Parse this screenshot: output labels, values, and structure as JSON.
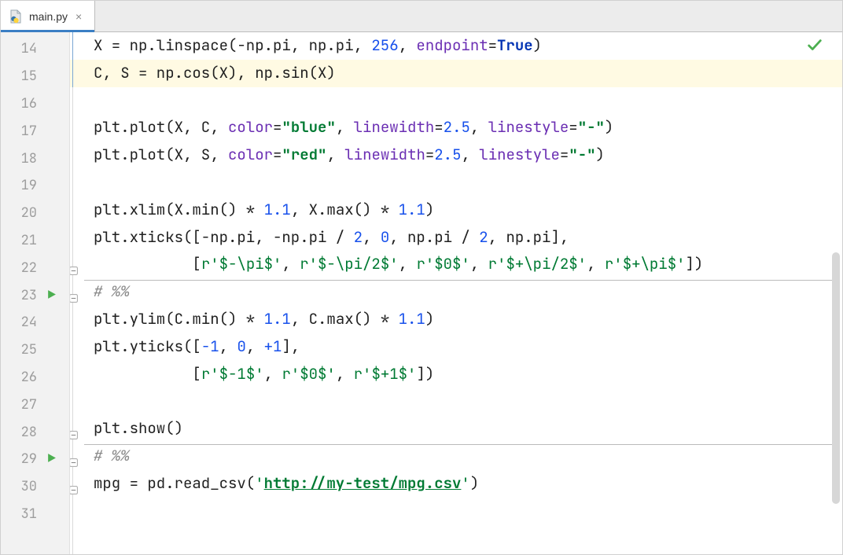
{
  "tab": {
    "filename": "main.py",
    "close_glyph": "×"
  },
  "analysis": {
    "status": "ok"
  },
  "gutter": {
    "first_line": 14,
    "run_markers": [
      23,
      29
    ]
  },
  "current_line": 15,
  "cell_separators": [
    22,
    28
  ],
  "code": {
    "14": [
      {
        "t": "X = np.linspace(-np.pi, np.pi, "
      },
      {
        "t": "256",
        "c": "tk-num"
      },
      {
        "t": ", "
      },
      {
        "t": "endpoint",
        "c": "tk-kwarg"
      },
      {
        "t": "="
      },
      {
        "t": "True",
        "c": "tk-kw"
      },
      {
        "t": ")"
      }
    ],
    "15": [
      {
        "t": "C, S = np.cos(X), np.sin(X)"
      }
    ],
    "16": [],
    "17": [
      {
        "t": "plt.plot(X, C, "
      },
      {
        "t": "color",
        "c": "tk-kwarg"
      },
      {
        "t": "="
      },
      {
        "t": "\"blue\"",
        "c": "tk-str"
      },
      {
        "t": ", "
      },
      {
        "t": "linewidth",
        "c": "tk-kwarg"
      },
      {
        "t": "="
      },
      {
        "t": "2.5",
        "c": "tk-num"
      },
      {
        "t": ", "
      },
      {
        "t": "linestyle",
        "c": "tk-kwarg"
      },
      {
        "t": "="
      },
      {
        "t": "\"-\"",
        "c": "tk-str"
      },
      {
        "t": ")"
      }
    ],
    "18": [
      {
        "t": "plt.plot(X, S, "
      },
      {
        "t": "color",
        "c": "tk-kwarg"
      },
      {
        "t": "="
      },
      {
        "t": "\"red\"",
        "c": "tk-str"
      },
      {
        "t": ", "
      },
      {
        "t": "linewidth",
        "c": "tk-kwarg"
      },
      {
        "t": "="
      },
      {
        "t": "2.5",
        "c": "tk-num"
      },
      {
        "t": ", "
      },
      {
        "t": "linestyle",
        "c": "tk-kwarg"
      },
      {
        "t": "="
      },
      {
        "t": "\"-\"",
        "c": "tk-str"
      },
      {
        "t": ")"
      }
    ],
    "19": [],
    "20": [
      {
        "t": "plt.xlim(X.min() * "
      },
      {
        "t": "1.1",
        "c": "tk-num"
      },
      {
        "t": ", X.max() * "
      },
      {
        "t": "1.1",
        "c": "tk-num"
      },
      {
        "t": ")"
      }
    ],
    "21": [
      {
        "t": "plt.xticks([-np.pi, -np.pi / "
      },
      {
        "t": "2",
        "c": "tk-num"
      },
      {
        "t": ", "
      },
      {
        "t": "0",
        "c": "tk-num"
      },
      {
        "t": ", np.pi / "
      },
      {
        "t": "2",
        "c": "tk-num"
      },
      {
        "t": ", np.pi],"
      }
    ],
    "22": [
      {
        "t": "           ["
      },
      {
        "t": "r'$-\\pi$'",
        "c": "tk-strp"
      },
      {
        "t": ", "
      },
      {
        "t": "r'$-\\pi/2$'",
        "c": "tk-strp"
      },
      {
        "t": ", "
      },
      {
        "t": "r'$0$'",
        "c": "tk-strp"
      },
      {
        "t": ", "
      },
      {
        "t": "r'$+\\pi/2$'",
        "c": "tk-strp"
      },
      {
        "t": ", "
      },
      {
        "t": "r'$+\\pi$'",
        "c": "tk-strp"
      },
      {
        "t": "])"
      }
    ],
    "23": [
      {
        "t": "# %%",
        "c": "tk-cm"
      }
    ],
    "24": [
      {
        "t": "plt.ylim(C.min() * "
      },
      {
        "t": "1.1",
        "c": "tk-num"
      },
      {
        "t": ", C.max() * "
      },
      {
        "t": "1.1",
        "c": "tk-num"
      },
      {
        "t": ")"
      }
    ],
    "25": [
      {
        "t": "plt.yticks(["
      },
      {
        "t": "-1",
        "c": "tk-num"
      },
      {
        "t": ", "
      },
      {
        "t": "0",
        "c": "tk-num"
      },
      {
        "t": ", "
      },
      {
        "t": "+1",
        "c": "tk-num"
      },
      {
        "t": "],"
      }
    ],
    "26": [
      {
        "t": "           ["
      },
      {
        "t": "r'$-1$'",
        "c": "tk-strp"
      },
      {
        "t": ", "
      },
      {
        "t": "r'$0$'",
        "c": "tk-strp"
      },
      {
        "t": ", "
      },
      {
        "t": "r'$+1$'",
        "c": "tk-strp"
      },
      {
        "t": "])"
      }
    ],
    "27": [],
    "28": [
      {
        "t": "plt.show()"
      }
    ],
    "29": [
      {
        "t": "# %%",
        "c": "tk-cm"
      }
    ],
    "30": [
      {
        "t": "mpg = pd.read_csv("
      },
      {
        "t": "'",
        "c": "tk-strp"
      },
      {
        "t": "http://my-test/mpg.csv",
        "c": "tk-url"
      },
      {
        "t": "'",
        "c": "tk-strp"
      },
      {
        "t": ")"
      }
    ],
    "31": []
  }
}
